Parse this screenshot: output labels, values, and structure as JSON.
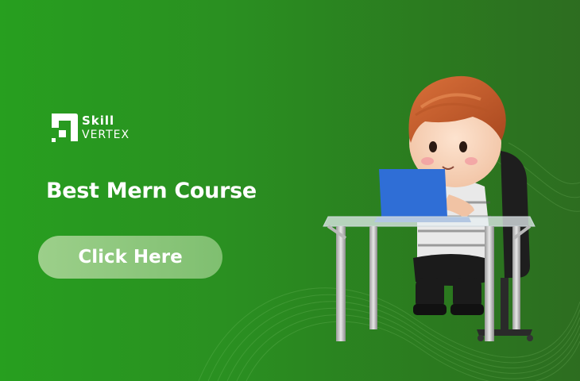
{
  "brand": {
    "name_top": "Skill",
    "name_bottom": "VERTEX",
    "logo_icon": "skill-vertex-logo-mark"
  },
  "headline": "Best Mern Course",
  "cta": {
    "label": "Click Here"
  },
  "colors": {
    "background_left": "#279f1f",
    "background_right": "#2d6d20",
    "button": "#8cc87b",
    "text": "#ffffff"
  },
  "illustration": {
    "icon": "student-at-laptop-illustration"
  }
}
